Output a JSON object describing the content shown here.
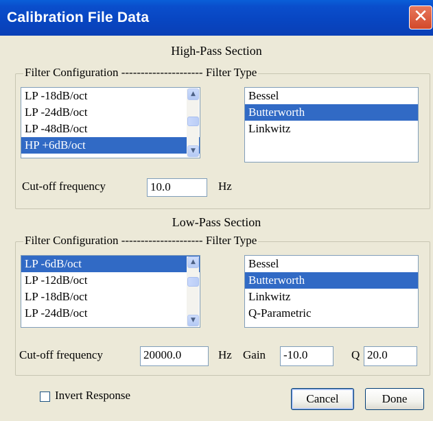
{
  "window": {
    "title": "Calibration File Data",
    "close_glyph": "✕"
  },
  "high_pass": {
    "section_title": "High-Pass Section",
    "frame_legend": "Filter Configuration --------------------- Filter Type",
    "config_items": [
      "LP -18dB/oct",
      "LP -24dB/oct",
      "LP -48dB/oct",
      "HP +6dB/oct"
    ],
    "config_selected": "HP +6dB/oct",
    "type_items": [
      "Bessel",
      "Butterworth",
      "Linkwitz"
    ],
    "type_selected": "Butterworth",
    "cutoff_label": "Cut-off frequency",
    "cutoff_value": "10.0",
    "cutoff_unit": "Hz"
  },
  "low_pass": {
    "section_title": "Low-Pass Section",
    "frame_legend": "Filter Configuration --------------------- Filter Type",
    "config_items": [
      "LP -6dB/oct",
      "LP -12dB/oct",
      "LP -18dB/oct",
      "LP -24dB/oct"
    ],
    "config_selected": "LP -6dB/oct",
    "type_items": [
      "Bessel",
      "Butterworth",
      "Linkwitz",
      "Q-Parametric"
    ],
    "type_selected": "Butterworth",
    "cutoff_label": "Cut-off frequency",
    "cutoff_value": "20000.0",
    "cutoff_unit": "Hz",
    "gain_label": "Gain",
    "gain_value": "-10.0",
    "q_label": "Q",
    "q_value": "20.0"
  },
  "footer": {
    "invert_label": "Invert Response",
    "invert_checked": false,
    "cancel_label": "Cancel",
    "done_label": "Done"
  },
  "icons": {
    "scroll_up": "▲",
    "scroll_down": "▼"
  },
  "colors": {
    "titlebar": "#0846c2",
    "selection": "#316ac5",
    "dialog_bg": "#ece9d8"
  }
}
